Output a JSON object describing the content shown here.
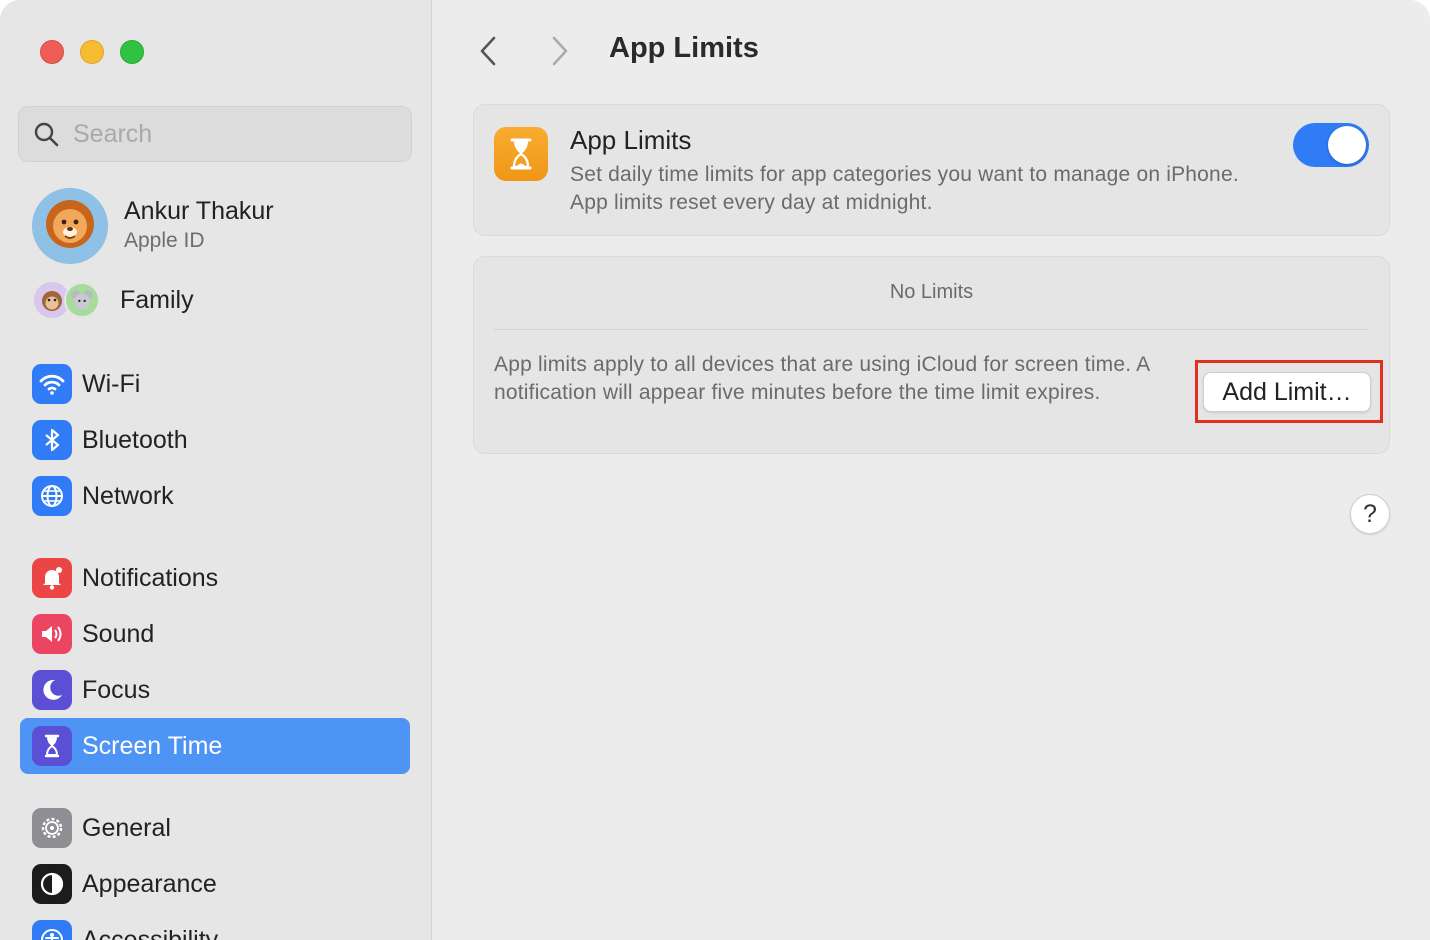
{
  "window": {
    "traffic_lights": [
      "close",
      "minimize",
      "zoom"
    ]
  },
  "sidebar": {
    "search_placeholder": "Search",
    "account": {
      "name": "Ankur Thakur",
      "subtitle": "Apple ID"
    },
    "family": {
      "label": "Family"
    },
    "items": [
      {
        "label": "Wi-Fi",
        "icon": "wifi-icon",
        "color": "#2f7cf6"
      },
      {
        "label": "Bluetooth",
        "icon": "bluetooth-icon",
        "color": "#2f7cf6"
      },
      {
        "label": "Network",
        "icon": "globe-icon",
        "color": "#2f7cf6"
      },
      {
        "label": "Notifications",
        "icon": "bell-icon",
        "color": "#ec4545"
      },
      {
        "label": "Sound",
        "icon": "speaker-icon",
        "color": "#ec4562"
      },
      {
        "label": "Focus",
        "icon": "moon-icon",
        "color": "#5b4fd6"
      },
      {
        "label": "Screen Time",
        "icon": "hourglass-icon",
        "color": "#5b4fd6",
        "selected": true
      },
      {
        "label": "General",
        "icon": "gear-icon",
        "color": "#8e8e93"
      },
      {
        "label": "Appearance",
        "icon": "appearance-icon",
        "color": "#1c1c1e"
      },
      {
        "label": "Accessibility",
        "icon": "accessibility-icon",
        "color": "#2f7cf6"
      }
    ]
  },
  "main": {
    "title": "App Limits",
    "app_limits_card": {
      "title": "App Limits",
      "description": "Set daily time limits for app categories you want to manage on iPhone. App limits reset every day at midnight.",
      "toggle_on": true,
      "icon": "hourglass-icon",
      "icon_color": "#f5a623"
    },
    "limits_card": {
      "empty_text": "No Limits",
      "description": "App limits apply to all devices that are using iCloud for screen time. A notification will appear five minutes before the time limit expires.",
      "add_button": "Add Limit…"
    },
    "help_button": "?"
  },
  "colors": {
    "accent": "#2f7cf6",
    "selection": "#4e94f5",
    "highlight_box": "#e0301e"
  }
}
